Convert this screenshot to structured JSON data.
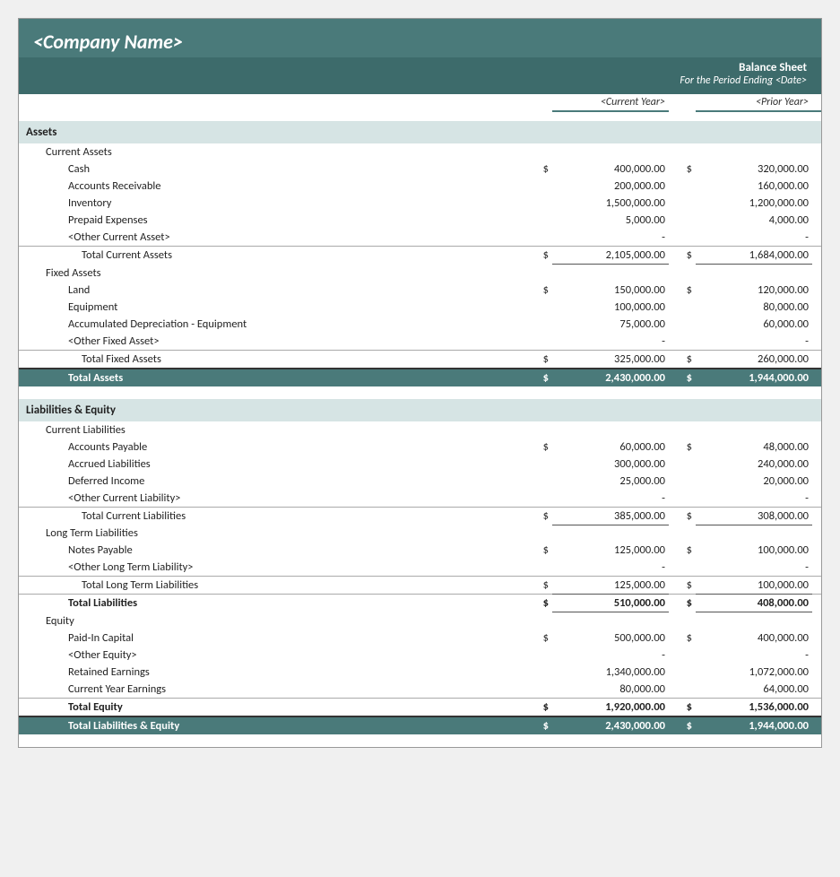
{
  "header": {
    "company_name": "<Company Name>",
    "report_title": "Balance Sheet",
    "report_subtitle": "For the Period Ending <Date>",
    "col_current": "<Current Year>",
    "col_prior": "<Prior Year>"
  },
  "sections": {
    "assets_label": "Assets",
    "current_assets_label": "Current Assets",
    "fixed_assets_label": "Fixed Assets",
    "liabilities_equity_label": "Liabilities & Equity",
    "current_liabilities_label": "Current Liabilities",
    "long_term_liabilities_label": "Long Term Liabilities",
    "equity_label": "Equity"
  },
  "assets": {
    "current": [
      {
        "label": "Cash",
        "dollar_sign": "$",
        "cy": "400,000.00",
        "py_dollar": "$",
        "py": "320,000.00"
      },
      {
        "label": "Accounts Receivable",
        "cy": "200,000.00",
        "py": "160,000.00"
      },
      {
        "label": "Inventory",
        "cy": "1,500,000.00",
        "py": "1,200,000.00"
      },
      {
        "label": "Prepaid Expenses",
        "cy": "5,000.00",
        "py": "4,000.00"
      },
      {
        "label": "<Other Current Asset>",
        "cy": "-",
        "py": "-"
      }
    ],
    "total_current": {
      "label": "Total Current Assets",
      "dollar_sign": "$",
      "cy": "2,105,000.00",
      "py_dollar": "$",
      "py": "1,684,000.00"
    },
    "fixed": [
      {
        "label": "Land",
        "dollar_sign": "$",
        "cy": "150,000.00",
        "py_dollar": "$",
        "py": "120,000.00"
      },
      {
        "label": "Equipment",
        "cy": "100,000.00",
        "py": "80,000.00"
      },
      {
        "label": "Accumulated Depreciation - Equipment",
        "cy": "75,000.00",
        "py": "60,000.00"
      },
      {
        "label": "<Other Fixed Asset>",
        "cy": "-",
        "py": "-"
      }
    ],
    "total_fixed": {
      "label": "Total Fixed Assets",
      "dollar_sign": "$",
      "cy": "325,000.00",
      "py_dollar": "$",
      "py": "260,000.00"
    },
    "total_assets": {
      "label": "Total Assets",
      "dollar_sign": "$",
      "cy": "2,430,000.00",
      "py_dollar": "$",
      "py": "1,944,000.00"
    }
  },
  "liabilities": {
    "current": [
      {
        "label": "Accounts Payable",
        "dollar_sign": "$",
        "cy": "60,000.00",
        "py_dollar": "$",
        "py": "48,000.00"
      },
      {
        "label": "Accrued Liabilities",
        "cy": "300,000.00",
        "py": "240,000.00"
      },
      {
        "label": "Deferred Income",
        "cy": "25,000.00",
        "py": "20,000.00"
      },
      {
        "label": "<Other Current Liability>",
        "cy": "-",
        "py": "-"
      }
    ],
    "total_current": {
      "label": "Total Current Liabilities",
      "dollar_sign": "$",
      "cy": "385,000.00",
      "py_dollar": "$",
      "py": "308,000.00"
    },
    "long_term": [
      {
        "label": "Notes Payable",
        "dollar_sign": "$",
        "cy": "125,000.00",
        "py_dollar": "$",
        "py": "100,000.00"
      },
      {
        "label": "<Other Long Term Liability>",
        "cy": "-",
        "py": "-"
      }
    ],
    "total_long_term": {
      "label": "Total Long Term Liabilities",
      "dollar_sign": "$",
      "cy": "125,000.00",
      "py_dollar": "$",
      "py": "100,000.00"
    },
    "total_liabilities": {
      "label": "Total Liabilities",
      "dollar_sign": "$",
      "cy": "510,000.00",
      "py_dollar": "$",
      "py": "408,000.00"
    }
  },
  "equity": {
    "items": [
      {
        "label": "Paid-In Capital",
        "dollar_sign": "$",
        "cy": "500,000.00",
        "py_dollar": "$",
        "py": "400,000.00"
      },
      {
        "label": "<Other Equity>",
        "cy": "-",
        "py": "-"
      },
      {
        "label": "Retained Earnings",
        "cy": "1,340,000.00",
        "py": "1,072,000.00"
      },
      {
        "label": "Current Year Earnings",
        "cy": "80,000.00",
        "py": "64,000.00"
      }
    ],
    "total_equity": {
      "label": "Total Equity",
      "dollar_sign": "$",
      "cy": "1,920,000.00",
      "py_dollar": "$",
      "py": "1,536,000.00"
    },
    "total_liabilities_equity": {
      "label": "Total Liabilities & Equity",
      "dollar_sign": "$",
      "cy": "2,430,000.00",
      "py_dollar": "$",
      "py": "1,944,000.00"
    }
  }
}
